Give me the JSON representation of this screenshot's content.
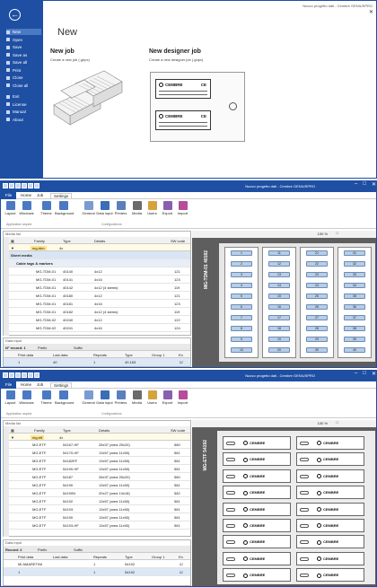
{
  "accent": "#1e4fa3",
  "screen1": {
    "window_title": "Nuovo progetto dati - Cembre GENIUSPRO",
    "heading": "New",
    "back_icon": "arrow-left-icon",
    "menu": [
      "New",
      "Open",
      "Save",
      "Save as",
      "Save all",
      "Print",
      "Close",
      "Close all",
      "Exit",
      "License",
      "Manual",
      "About"
    ],
    "job_title": "New job",
    "job_subtitle": "Create a new job (.gepx)",
    "designer_title": "New designer job",
    "designer_subtitle": "Create a new designer job (.gdpx)",
    "brand": "CEMBRE",
    "mark": "CE"
  },
  "screen2": {
    "window_title": "Nuovo progetto dati - Cembre GENIUSPRO",
    "tabs": [
      "File",
      "Home",
      "Job",
      "Settings"
    ],
    "ribbon": [
      "Layout",
      "Windows",
      "Theme",
      "Background",
      "General",
      "Data input",
      "Printers",
      "Media",
      "Users",
      "Export",
      "Import"
    ],
    "groups": [
      "Application aspect",
      "Configurations"
    ],
    "media_list_label": "Media list",
    "cols": [
      "Family",
      "Type",
      "Details",
      "SW code"
    ],
    "filter": [
      "mg-tdm",
      "4x"
    ],
    "section": "Sheet media",
    "subsection": "Cable tags & markers",
    "rows": [
      [
        "MG-TDM-01",
        "40140",
        "4x12",
        "121"
      ],
      [
        "MG-TDM-01",
        "40141",
        "4x16",
        "123"
      ],
      [
        "MG-TDM-01",
        "40142",
        "4x12 (4 stems)",
        "119"
      ],
      [
        "MG-TDM-01",
        "40180",
        "4x12",
        "121"
      ],
      [
        "MG-TDM-01",
        "40181",
        "4x16",
        "123"
      ],
      [
        "MG-TDM-01",
        "40182",
        "4x12 (4 stems)",
        "119"
      ],
      [
        "MG-TDM-02",
        "40240",
        "4x12",
        "122"
      ],
      [
        "MG-TDM-02",
        "40241",
        "4x16",
        "124"
      ]
    ],
    "data_input_label": "Data input",
    "record": "N° record: 1",
    "prefix": "Prefix",
    "suffix": "Suffix",
    "dcols": [
      "Print data",
      "Last data",
      "Repeats",
      "Type",
      "Group 1",
      "En"
    ],
    "drow": [
      "1",
      "40",
      "1",
      "40.163"
    ],
    "zoom": "100 %",
    "vertical": "MG-TDM-01 40182",
    "marks": [
      [
        "1",
        "11",
        "21",
        "31"
      ],
      [
        "2",
        "12",
        "22",
        "32"
      ],
      [
        "3",
        "13",
        "23",
        "33"
      ],
      [
        "4",
        "14",
        "24",
        "34"
      ],
      [
        "5",
        "15",
        "25",
        "35"
      ],
      [
        "6",
        "16",
        "26",
        "36"
      ],
      [
        "7",
        "17",
        "27",
        "37"
      ],
      [
        "8",
        "18",
        "28",
        "38"
      ],
      [
        "9",
        "19",
        "29",
        "39"
      ],
      [
        "10",
        "20",
        "30",
        "40"
      ]
    ]
  },
  "screen3": {
    "window_title": "Nuovo progetto dati - Cembre GENIUSPRO",
    "tabs": [
      "File",
      "Home",
      "Job",
      "Settings"
    ],
    "ribbon": [
      "Layout",
      "Windows",
      "Theme",
      "Background",
      "General",
      "Data input",
      "Printers",
      "Media",
      "Users",
      "Export",
      "Import"
    ],
    "groups": [
      "Application aspect",
      "Configurations"
    ],
    "media_list_label": "Media list",
    "cols": [
      "Family",
      "Type",
      "Details",
      "SW code"
    ],
    "filter": [
      "mg-etf",
      "4x"
    ],
    "rows": [
      [
        "MG-ETF",
        "54167-HF",
        "28x37 (area 25x20)",
        "580"
      ],
      [
        "MG-ETF",
        "54170-HF",
        "13x57 (area 11x50)",
        "581"
      ],
      [
        "MG-ETF",
        "54182EF",
        "13x57 (area 11x50)",
        "581"
      ],
      [
        "MG-ETF",
        "54190-HF",
        "13x57 (area 11x50)",
        "581"
      ],
      [
        "MG-ETF",
        "54187",
        "28x37 (area 25x20)",
        "580"
      ],
      [
        "MG-ETF",
        "54190",
        "13x57 (area 11x50)",
        "581"
      ],
      [
        "MG-ETF",
        "54190N",
        "20x27 (area 13x18)",
        "582"
      ],
      [
        "MG-ETF",
        "54192",
        "13x57 (area 11x50)",
        "581"
      ],
      [
        "MG-ETF",
        "54193",
        "13x57 (area 11x50)",
        "581"
      ],
      [
        "MG-ETF",
        "54190",
        "13x57 (area 11x50)",
        "581"
      ],
      [
        "MG-ETF",
        "54193-HF",
        "13x57 (area 11x50)",
        "581"
      ]
    ],
    "data_input_label": "Data input",
    "record": "Record: 2",
    "prefix": "Prefix",
    "suffix": "Suffix",
    "dcols": [
      "Print data",
      "Last data",
      "Repeats",
      "Type",
      "Group 1",
      "En"
    ],
    "drows": [
      [
        "MI AMARETINI",
        "1",
        "54192"
      ],
      [
        "1",
        "1",
        "54192"
      ]
    ],
    "zoom": "100 %",
    "vertical": "MG-ETF 54192",
    "brand": "CEMBRE"
  }
}
